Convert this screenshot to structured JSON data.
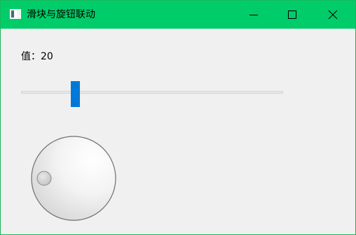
{
  "window": {
    "title": "滑块与旋钮联动",
    "title_bar_color": "#00cc6a"
  },
  "titlebar_buttons": {
    "minimize_icon": "minimize-icon",
    "maximize_icon": "maximize-icon",
    "close_icon": "close-icon"
  },
  "value_display": {
    "label": "值：",
    "value": "20"
  },
  "slider": {
    "value": 20,
    "min": 0,
    "max": 100,
    "thumb_color": "#0078d7"
  },
  "dial": {
    "value": 20,
    "min": 0,
    "max": 100
  }
}
